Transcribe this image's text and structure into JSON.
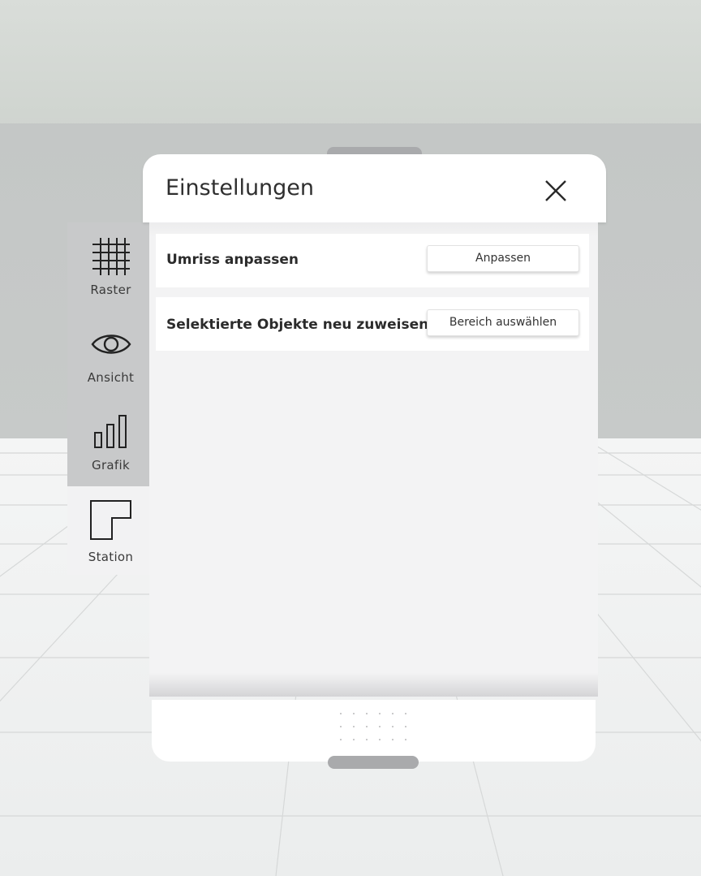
{
  "panel": {
    "title": "Einstellungen",
    "rows": [
      {
        "label": "Umriss anpassen",
        "button": "Anpassen"
      },
      {
        "label": "Selektierte Objekte neu zuweisen",
        "button": "Bereich auswählen"
      }
    ]
  },
  "side_tabs": [
    {
      "label": "Raster",
      "icon": "grid-icon",
      "active": false
    },
    {
      "label": "Ansicht",
      "icon": "eye-icon",
      "active": false
    },
    {
      "label": "Grafik",
      "icon": "bar-chart-icon",
      "active": false
    },
    {
      "label": "Station",
      "icon": "floorplan-icon",
      "active": true
    }
  ],
  "colors": {
    "panel_bg": "#ffffff",
    "body_bg": "#f3f3f4",
    "tab_bar_bg": "#c8c9ca",
    "active_tab_bg": "#f2f2f3",
    "handle": "#a9aaac"
  }
}
